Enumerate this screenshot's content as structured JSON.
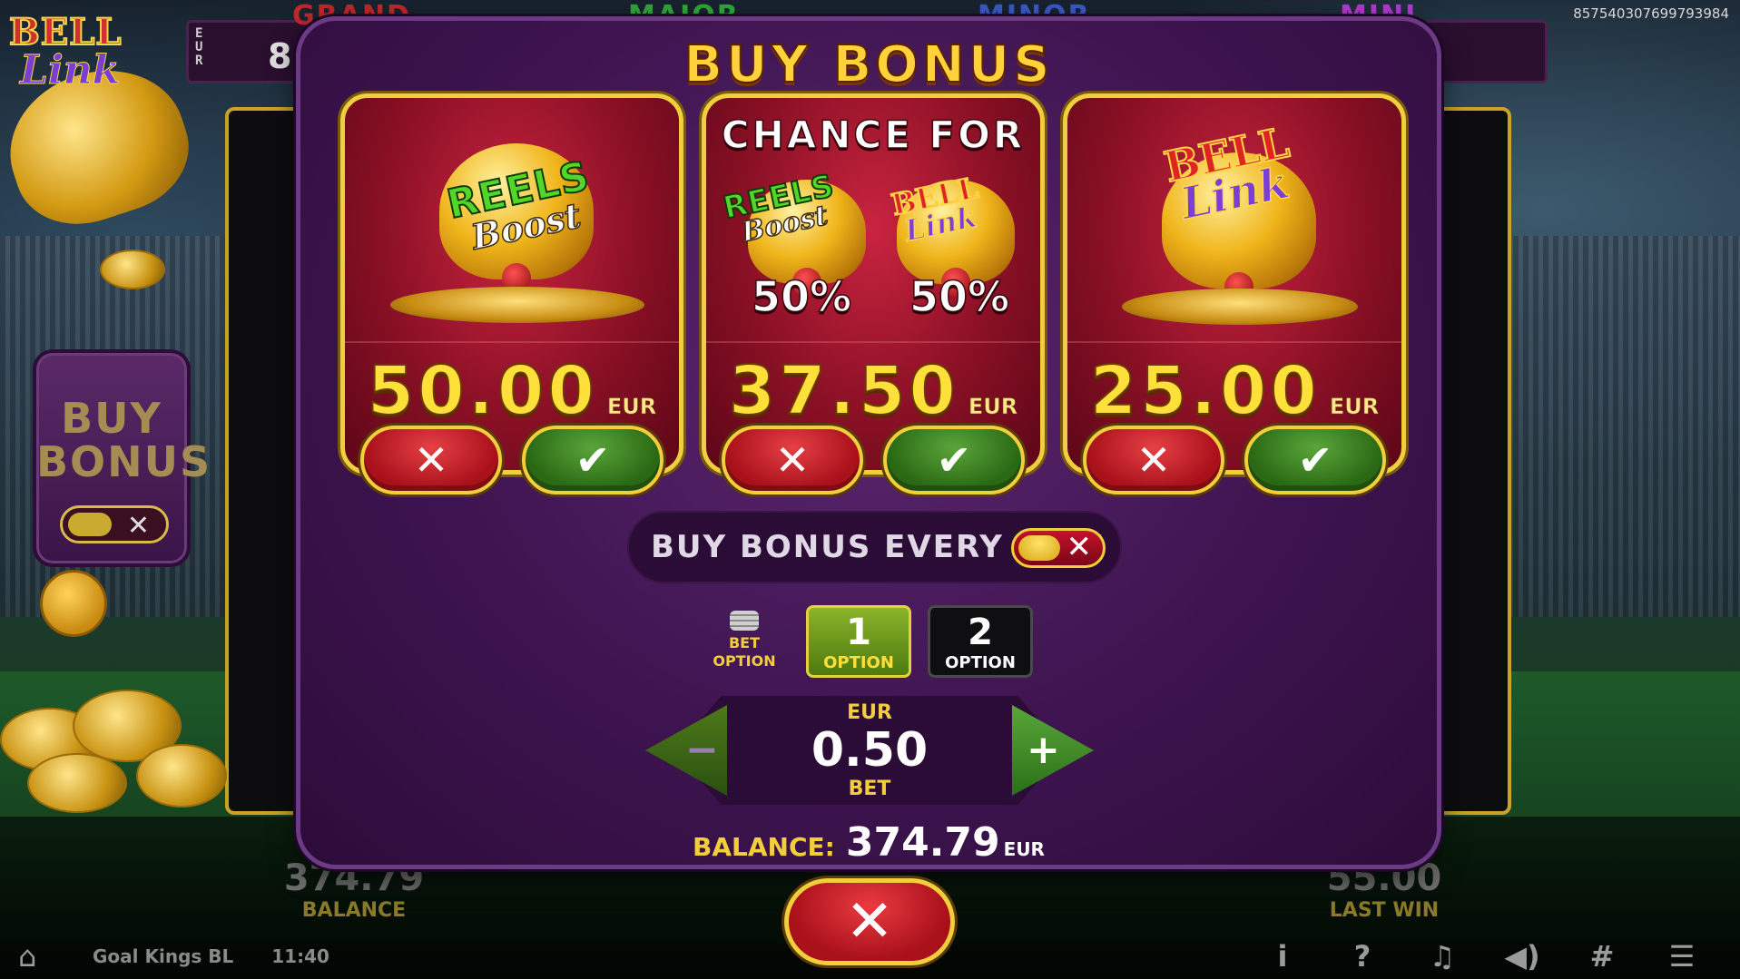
{
  "session_id": "85754030769979398​4",
  "jackpots": {
    "grand": "GRAND",
    "major": "MAJOR",
    "minor": "MINOR",
    "mini": "MINI",
    "currency_vertical": "E\nU\nR",
    "grand_value_partial": "8"
  },
  "logo": {
    "line1": "BELL",
    "line2": "Link"
  },
  "side_buy_bonus": {
    "line1": "BUY",
    "line2": "BONUS",
    "toggle_icon": "close-icon"
  },
  "bottom": {
    "balance_value": "374.79",
    "balance_label": "BALANCE",
    "last_win_value": "55.00",
    "last_win_label": "LAST WIN"
  },
  "taskbar": {
    "home_icon": "home-icon",
    "game_name": "Goal Kings BL",
    "clock": "11:40",
    "icons": [
      "i",
      "?",
      "♫",
      "🔊",
      "⧉",
      "☰"
    ]
  },
  "modal": {
    "title": "BUY BONUS",
    "cards": [
      {
        "id": "reels-boost",
        "logo_top": "REELS",
        "logo_bottom": "Boost",
        "price": "50.00",
        "currency": "EUR"
      },
      {
        "id": "chance",
        "title": "CHANCE FOR",
        "left_pct": "50%",
        "right_pct": "50%",
        "left_logo_top": "REELS",
        "left_logo_bottom": "Boost",
        "right_logo_top": "BELL",
        "right_logo_bottom": "Link",
        "price": "37.50",
        "currency": "EUR"
      },
      {
        "id": "bell-link",
        "logo_top": "BELL",
        "logo_bottom": "Link",
        "price": "25.00",
        "currency": "EUR"
      }
    ],
    "reject_symbol": "✕",
    "accept_symbol": "✔",
    "every_spin_label": "BUY BONUS EVERY SPIN",
    "every_spin_enabled": false,
    "bet_option_label_1": "BET",
    "bet_option_label_2": "OPTION",
    "options": [
      {
        "number": "1",
        "label": "OPTION",
        "selected": true
      },
      {
        "number": "2",
        "label": "OPTION",
        "selected": false
      }
    ],
    "bet_currency": "EUR",
    "bet_value": "0.50",
    "bet_label": "BET",
    "minus_symbol": "−",
    "plus_symbol": "+",
    "balance_label": "BALANCE:",
    "balance_value": "374.79",
    "balance_currency": "EUR",
    "close_symbol": "✕"
  },
  "colors": {
    "gold": "#f2cf3a",
    "modal_purple": "#3e1450",
    "card_red": "#8a1025",
    "accept_green": "#2a6814",
    "reject_red": "#a8101a"
  }
}
